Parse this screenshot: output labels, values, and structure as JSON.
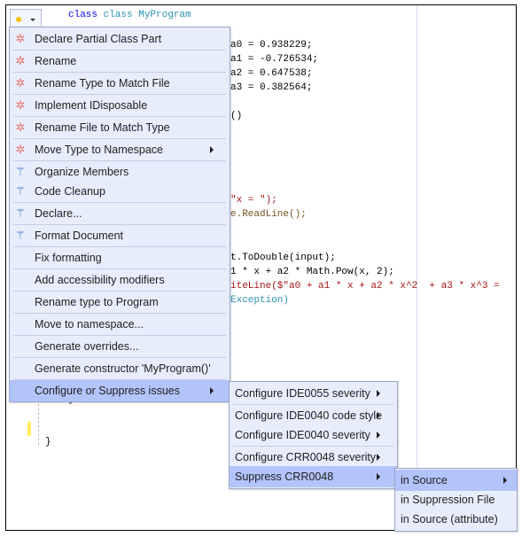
{
  "editor": {
    "lines": [
      {
        "t": "class MyProgram"
      },
      {
        "t": "a0 = 0.938229;"
      },
      {
        "t": "a1 = -0.726534;"
      },
      {
        "t": "a2 = 0.647538;"
      },
      {
        "t": "a3 = 0.382564;"
      },
      {
        "t": "()"
      },
      {
        "t": "\"x = \");"
      },
      {
        "t": "e.ReadLine();"
      },
      {
        "t": "t.ToDouble(input);"
      },
      {
        "t": "1 * x + a2 * Math.Pow(x, 2);"
      },
      {
        "t": "iteLine($\"a0 + a1 * x + a2 * x^2  + a3 * x^3 ="
      },
      {
        "t": "Exception)"
      },
      {
        "t": "}"
      },
      {
        "t": "}"
      }
    ]
  },
  "quick_actions": {
    "icon": "lightbulb-icon",
    "items": [
      {
        "label": "Declare Partial Class Part",
        "icon": "gear-icon"
      },
      {
        "label": "Rename",
        "icon": "gear-icon"
      },
      {
        "label": "Rename Type to Match File",
        "icon": "gear-icon"
      },
      {
        "label": "Implement IDisposable",
        "icon": "gear-icon"
      },
      {
        "label": "Rename File to Match Type",
        "icon": "gear-icon"
      },
      {
        "label": "Move Type to Namespace",
        "icon": "gear-icon",
        "submenu": true
      },
      {
        "label": "Organize Members",
        "icon": "magic-wand-icon"
      },
      {
        "label": "Code Cleanup",
        "icon": "magic-wand-icon"
      },
      {
        "label": "Declare...",
        "icon": "magic-wand-icon"
      },
      {
        "label": "Format Document",
        "icon": "magic-wand-icon"
      },
      {
        "label": "Fix formatting"
      },
      {
        "label": "Add accessibility modifiers"
      },
      {
        "label": "Rename type to Program"
      },
      {
        "label": "Move to namespace..."
      },
      {
        "label": "Generate overrides..."
      },
      {
        "label": "Generate constructor 'MyProgram()'"
      },
      {
        "label": "Configure or Suppress issues",
        "submenu": true,
        "highlighted": true
      }
    ]
  },
  "configure_submenu": [
    {
      "label": "Configure IDE0055 severity"
    },
    {
      "label": "Configure IDE0040 code style"
    },
    {
      "label": "Configure IDE0040 severity"
    },
    {
      "label": "Configure CRR0048 severity"
    },
    {
      "label": "Suppress CRR0048",
      "highlighted": true
    }
  ],
  "suppress_submenu": [
    {
      "label": "in Source",
      "highlighted": true,
      "submenu": true
    },
    {
      "label": "in Suppression File"
    },
    {
      "label": "in Source (attribute)"
    }
  ],
  "colors": {
    "menu_bg": "#e8edfc",
    "highlight": "#b3c4fb",
    "keyword": "#0000ff",
    "type": "#2b91af",
    "string": "#a31515"
  }
}
